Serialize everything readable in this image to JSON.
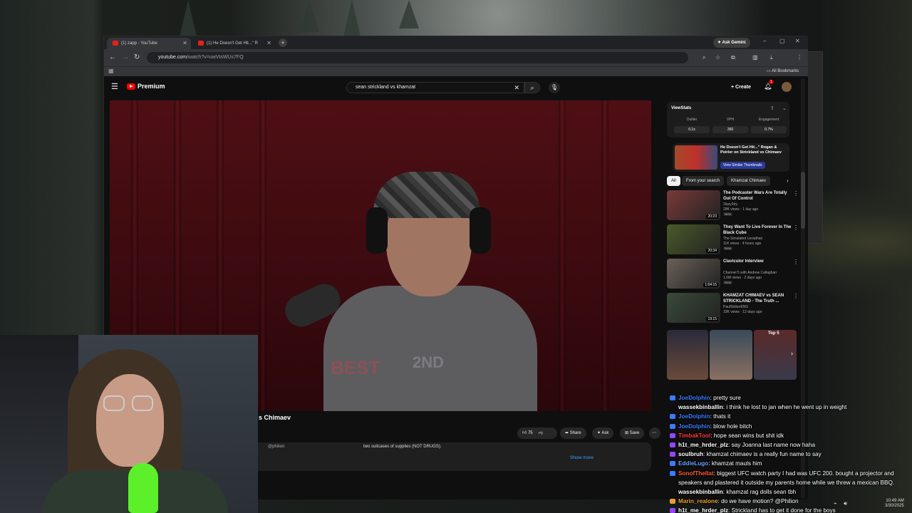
{
  "browser": {
    "tabs": [
      {
        "label": "(1) zapp - YouTube"
      },
      {
        "label": "(1) He Doesn't Get Hit...\" R"
      }
    ],
    "ask_gemini": "Ask Gemini",
    "url_host": "youtube.com",
    "url_path": "/watch?v=uwVtsWUs7FQ",
    "all_bookmarks": "All Bookmarks"
  },
  "youtube": {
    "logo_text": "Premium",
    "search_value": "sean strickland vs khamzat",
    "create_label": "Create",
    "notif_count": "1",
    "video_title": "s Chimaev",
    "actions": {
      "likes": "75",
      "share": "Share",
      "ask": "Ask",
      "save": "Save"
    },
    "desc_user": "@philion",
    "desc_text": "two suitcases of supplies (NOT DRUGS).",
    "show_more": "Show more"
  },
  "extension": {
    "logo": "ViewStats",
    "stats": [
      {
        "label": "Outlier",
        "value": "0.1x"
      },
      {
        "label": "VPH",
        "value": "260"
      },
      {
        "label": "Engagement",
        "value": "0.7%"
      }
    ],
    "video_title": "He Doesn't Get Hit...\" Rogan & Poirier on Strickland vs Chimaev",
    "similar_btn": "View Similar Thumbnails"
  },
  "chips": [
    "All",
    "From your search",
    "Khamzat Chimaev"
  ],
  "related": [
    {
      "title": "The Podcaster Wars Are Totally Out Of Control",
      "channel": "2lazy2try",
      "meta": "28K views · 1 day ago",
      "badge": "New",
      "duration": "20:23",
      "color": "#7a3a3a"
    },
    {
      "title": "They Want To Live Forever In The Black Cube",
      "channel": "The Simulated Leviathan",
      "meta": "11K views · 4 hours ago",
      "badge": "New",
      "duration": "20:34",
      "color": "#4a5a2a"
    },
    {
      "title": "Claviculor Interview",
      "channel": "Channel 5 with Andrew Callaghan",
      "meta": "1.6M views · 2 days ago",
      "badge": "New",
      "duration": "1:04:15",
      "color": "#6a6058"
    },
    {
      "title": "KHAMZAT CHIMAEV vs SEAN STRICKLAND - The Truth ...",
      "channel": "PaulStrikerENG",
      "meta": "33K views · 12 days ago",
      "badge": "",
      "duration": "19:15",
      "color": "#3a4a3a"
    }
  ],
  "shorts_header": "Top 5",
  "chat": [
    {
      "user": "JoeDolphin",
      "text": "pretty sure",
      "color": "#3a7bff",
      "badge": "#3a7bff"
    },
    {
      "user": "wassekbinballin",
      "text": "i think he lost to jan when he went up in weight",
      "color": "#ffffff",
      "badge": ""
    },
    {
      "user": "JoeDolphin",
      "text": "thats it",
      "color": "#3a7bff",
      "badge": "#3a7bff"
    },
    {
      "user": "JoeDolphin",
      "text": "blow hole bitch",
      "color": "#3a7bff",
      "badge": "#3a7bff"
    },
    {
      "user": "TimbakTool",
      "text": "hope sean wins but shit idk",
      "color": "#ff3a3a",
      "badge": "#9146ff"
    },
    {
      "user": "h1t_me_hrder_plz",
      "text": "say Joanna last name now haha",
      "color": "#ffffff",
      "badge": "#9146ff"
    },
    {
      "user": "soulbruh",
      "text": "khamzat chimaev is a really fun name to say",
      "color": "#ffffff",
      "badge": "#9146ff"
    },
    {
      "user": "EddieLugo",
      "text": "khamzat mauls him",
      "color": "#6aa0ff",
      "badge": "#3a7bff"
    },
    {
      "user": "SonofThellat",
      "text": "biggest UFC watch party I had was UFC 200. bought a projector and speakers and plastered it outside my parents home while we threw a mexican BBQ.",
      "color": "#ff5a3a",
      "badge": "#3a7bff"
    },
    {
      "user": "wassekbinballin",
      "text": "khamzat rag dolls sean tbh",
      "color": "#ffffff",
      "badge": ""
    },
    {
      "user": "Marin_realone",
      "text": "do we have motion? @Philion",
      "color": "#e8a030",
      "badge": "#e8a030"
    },
    {
      "user": "h1t_me_hrder_plz",
      "text": "Strickland has to get it done for the boys",
      "color": "#ffffff",
      "badge": "#9146ff"
    }
  ],
  "tray": {
    "time": "10:49 AM",
    "date": "3/30/2025"
  }
}
